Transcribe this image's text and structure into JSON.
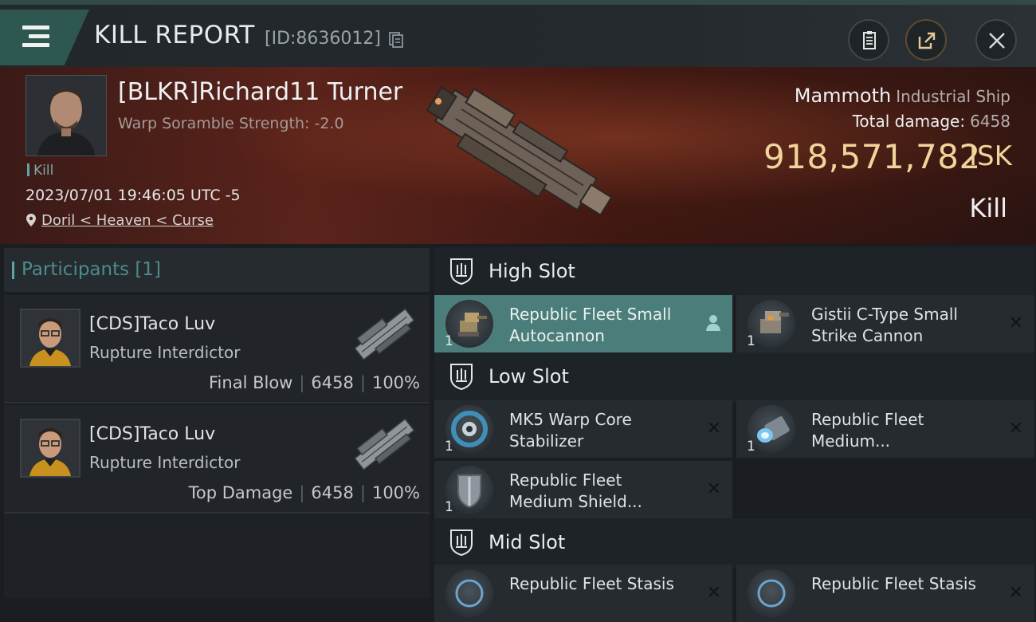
{
  "header": {
    "title": "KILL REPORT",
    "report_id": "[ID:8636012]"
  },
  "victim": {
    "name": "[BLKR]Richard11 Turner",
    "scramble": "Warp Soramble Strength: -2.0",
    "tag": "Kill",
    "date": "2023/07/01 19:46:05 UTC -5",
    "location": "Doril < Heaven < Curse"
  },
  "ship": {
    "name": "Mammoth",
    "class": "Industrial Ship",
    "total_damage_label": "Total damage:",
    "total_damage": "6458",
    "isk_value": "918,571,782",
    "isk_unit": "ISK",
    "kill_type": "Kill"
  },
  "participants": {
    "label": "Participants [1]",
    "items": [
      {
        "name": "[CDS]Taco Luv",
        "ship": "Rupture Interdictor",
        "role": "Final Blow",
        "damage": "6458",
        "percent": "100%"
      },
      {
        "name": "[CDS]Taco Luv",
        "ship": "Rupture Interdictor",
        "role": "Top Damage",
        "damage": "6458",
        "percent": "100%"
      }
    ]
  },
  "slots": {
    "high": {
      "label": "High Slot",
      "items": [
        {
          "qty": "1",
          "name": "Republic Fleet Small Autocannon",
          "icon": "autocannon-icon"
        },
        {
          "qty": "1",
          "name": "Gistii C-Type Small Strike Cannon",
          "icon": "strike-cannon-icon"
        }
      ]
    },
    "low": {
      "label": "Low Slot",
      "items": [
        {
          "qty": "1",
          "name": "MK5 Warp Core Stabilizer",
          "icon": "warp-core-icon"
        },
        {
          "qty": "1",
          "name": "Republic Fleet Medium...",
          "icon": "thruster-icon"
        },
        {
          "qty": "1",
          "name": "Republic Fleet Medium Shield...",
          "icon": "shield-module-icon"
        }
      ]
    },
    "mid": {
      "label": "Mid Slot",
      "items": [
        {
          "qty": "1",
          "name": "Republic Fleet Stasis",
          "icon": "stasis-icon"
        },
        {
          "qty": "1",
          "name": "Republic Fleet Stasis",
          "icon": "stasis-icon"
        }
      ]
    }
  },
  "colors": {
    "accent": "#5aa6a6",
    "isk_gold": "#f1d49a",
    "active_slot": "#4b7e7a"
  }
}
